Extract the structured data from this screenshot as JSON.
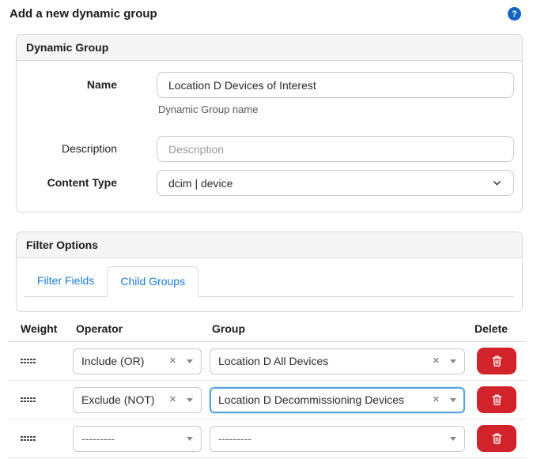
{
  "header": {
    "title": "Add a new dynamic group",
    "help_label": "?"
  },
  "dynamic_group_panel": {
    "title": "Dynamic Group",
    "name_field": {
      "label": "Name",
      "value": "Location D Devices of Interest",
      "help_text": "Dynamic Group name"
    },
    "description_field": {
      "label": "Description",
      "placeholder": "Description"
    },
    "content_type_field": {
      "label": "Content Type",
      "value": "dcim | device"
    }
  },
  "filter_options_panel": {
    "title": "Filter Options",
    "tabs": [
      {
        "label": "Filter Fields",
        "active": false
      },
      {
        "label": "Child Groups",
        "active": true
      }
    ]
  },
  "child_groups": {
    "columns": [
      "Weight",
      "Operator",
      "Group",
      "Delete"
    ],
    "rows": [
      {
        "operator": "Include (OR)",
        "operator_placeholder": false,
        "operator_clearable": true,
        "group": "Location D All Devices",
        "group_placeholder": false,
        "group_clearable": true,
        "group_focused": false
      },
      {
        "operator": "Exclude (NOT)",
        "operator_placeholder": false,
        "operator_clearable": true,
        "group": "Location D Decommissioning Devices",
        "group_placeholder": false,
        "group_clearable": true,
        "group_focused": true
      },
      {
        "operator": "---------",
        "operator_placeholder": true,
        "operator_clearable": false,
        "group": "---------",
        "group_placeholder": true,
        "group_clearable": false,
        "group_focused": false
      }
    ]
  },
  "colors": {
    "accent_blue": "#1a7cd7",
    "help_blue": "#1565c0",
    "danger_red": "#d2232a",
    "focus_blue": "#57a2e2",
    "panel_header_bg": "#f5f5f5",
    "border": "#d9d9d9"
  }
}
